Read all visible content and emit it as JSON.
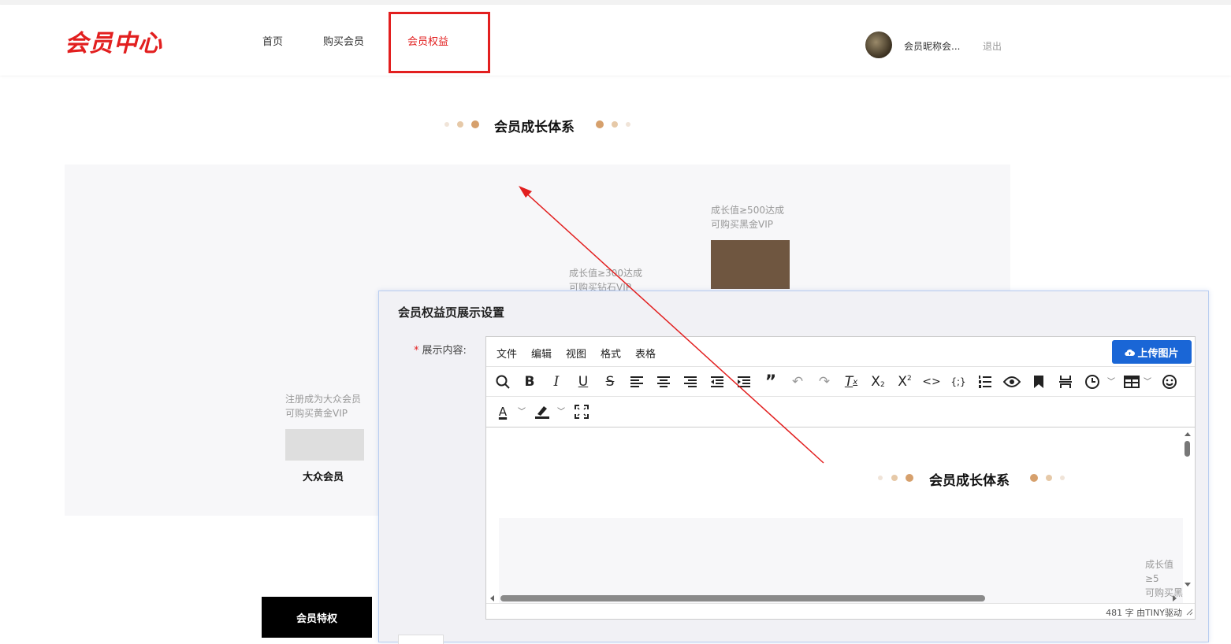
{
  "header": {
    "logo": "会员中心",
    "nav": [
      {
        "label": "首页"
      },
      {
        "label": "购买会员"
      },
      {
        "label": "会员权益"
      }
    ],
    "nickname": "会员昵称会...",
    "logout": "退出"
  },
  "growth": {
    "title": "会员成长体系",
    "dot_colors": [
      "#f0e4d8",
      "#e6c9a8",
      "#d6a06c"
    ],
    "tiers": [
      {
        "desc_line1": "注册成为大众会员",
        "desc_line2": "可购买黄金VIP",
        "name": "大众会员",
        "color": "#dedede"
      },
      {
        "desc_line1": "成长值≥300达成",
        "desc_line2": "可购买钻石VIP"
      },
      {
        "desc_line1": "成长值≥500达成",
        "desc_line2": "可购买黑金VIP",
        "color": "#6f5640"
      }
    ]
  },
  "privilege": {
    "label": "会员特权"
  },
  "dialog": {
    "title": "会员权益页展示设置",
    "field_required": "*",
    "field_label": "展示内容:",
    "menubar": [
      "文件",
      "编辑",
      "视图",
      "格式",
      "表格"
    ],
    "upload_label": "上传图片",
    "toolbar1_icons": [
      "search-icon",
      "bold-icon",
      "italic-icon",
      "underline-icon",
      "strikethrough-icon",
      "align-left-icon",
      "align-center-icon",
      "align-right-icon",
      "outdent-icon",
      "indent-icon",
      "blockquote-icon",
      "undo-icon",
      "redo-icon",
      "clear-format-icon",
      "subscript-icon",
      "superscript-icon",
      "code-icon",
      "code-sample-icon",
      "numbered-list-icon",
      "preview-icon",
      "bookmark-icon",
      "page-break-icon",
      "clock-icon",
      "table-icon",
      "emoji-icon"
    ],
    "toolbar2_icons": [
      "text-color-icon",
      "highlight-icon",
      "fullscreen-icon"
    ],
    "preview": {
      "title": "会员成长体系",
      "desc_line1": "成长值≥5",
      "desc_line2": "可购买黑"
    },
    "status": "481 字  由TINY驱动"
  }
}
